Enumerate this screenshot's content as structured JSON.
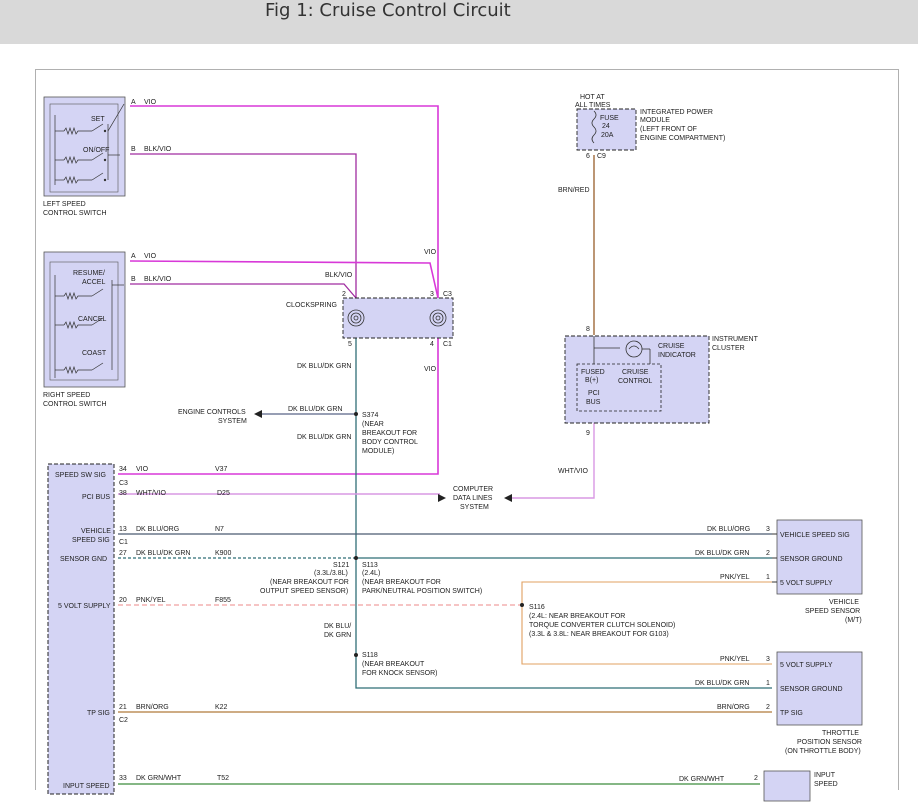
{
  "title": "Fig 1: Cruise Control Circuit",
  "colors": {
    "vio": "#d838d8",
    "blk_vio": "#a02ca0",
    "brn_red": "#a06a3a",
    "dk_blu_dk_grn": "#2f6e76",
    "wht_vio": "#d898e4",
    "pnk_yel": "#f0a0a0",
    "dk_blu_org": "#4a5a70",
    "brn_org": "#b07a3a",
    "dk_grn_wht": "#3c8c3c",
    "orange": "#e0a060",
    "component_fill": "#d4d4f4"
  },
  "labels": {
    "left_switch": [
      "LEFT SPEED",
      "CONTROL SWITCH"
    ],
    "set": "SET",
    "on_off": "ON/OFF",
    "right_switch": [
      "RIGHT SPEED",
      "CONTROL SWITCH"
    ],
    "resume_accel": [
      "RESUME/",
      "ACCEL"
    ],
    "cancel": "CANCEL",
    "coast": "COAST",
    "hot_at_all_times": [
      "HOT AT",
      "ALL TIMES"
    ],
    "fuse": [
      "FUSE",
      "24",
      "20A"
    ],
    "ipm": [
      "INTEGRATED POWER",
      "MODULE",
      "(LEFT FRONT OF",
      "ENGINE COMPARTMENT)"
    ],
    "clockspring": "CLOCKSPRING",
    "instrument_cluster": [
      "INSTRUMENT",
      "CLUSTER"
    ],
    "cruise_indicator": [
      "CRUISE",
      "INDICATOR"
    ],
    "fused_b": [
      "FUSED",
      "B(+)"
    ],
    "cruise_control": [
      "CRUISE",
      "CONTROL"
    ],
    "pci_bus_cluster": [
      "PCI",
      "BUS"
    ],
    "engine_controls": [
      "ENGINE CONTROLS",
      "SYSTEM"
    ],
    "s374": [
      "S374",
      "(NEAR",
      "BREAKOUT FOR",
      "BODY CONTROL",
      "MODULE)"
    ],
    "computer_data": [
      "COMPUTER",
      "DATA LINES",
      "SYSTEM"
    ],
    "s121": [
      "S121",
      "(3.3L/3.8L)",
      "(NEAR BREAKOUT FOR",
      "OUTPUT SPEED SENSOR)"
    ],
    "s113": [
      "S113",
      "(2.4L)",
      "(NEAR BREAKOUT FOR",
      "PARK/NEUTRAL POSITION SWITCH)"
    ],
    "s116": [
      "S116",
      "(2.4L: NEAR BREAKOUT FOR",
      "TORQUE CONVERTER CLUTCH SOLENOID)",
      "(3.3L & 3.8L: NEAR BREAKOUT FOR G103)"
    ],
    "s118": [
      "S118",
      "(NEAR BREAKOUT",
      "FOR KNOCK SENSOR)"
    ],
    "dk_blu_dk_grn_split": [
      "DK BLU/",
      "DK GRN"
    ],
    "vss_name": [
      "VEHICLE",
      "SPEED SENSOR",
      "(M/T)"
    ],
    "tps_name": [
      "THROTTLE",
      "POSITION SENSOR",
      "(ON THROTTLE BODY)"
    ],
    "input_speed": [
      "INPUT",
      "SPEED"
    ]
  },
  "wires": {
    "vio": "VIO",
    "blk_vio": "BLK/VIO",
    "brn_red": "BRN/RED",
    "dk_blu_dk_grn": "DK BLU/DK GRN",
    "wht_vio": "WHT/VIO",
    "dk_blu_org": "DK BLU/ORG",
    "pnk_yel": "PNK/YEL",
    "brn_org": "BRN/ORG",
    "dk_grn_wht": "DK GRN/WHT"
  },
  "pins": {
    "a": "A",
    "b": "B",
    "c3": "C3",
    "c1": "C1",
    "c9": "C9",
    "p2": "2",
    "p3": "3",
    "p4": "4",
    "p5": "5",
    "p6": "6",
    "p8": "8",
    "p9": "9",
    "p1": "1"
  },
  "pcm_rows": [
    {
      "name": "SPEED SW SIG",
      "pin": "34",
      "wire": "VIO",
      "circuit": "V37",
      "conn": "C3"
    },
    {
      "name": "PCI BUS",
      "pin": "38",
      "wire": "WHT/VIO",
      "circuit": "D25",
      "conn": ""
    },
    {
      "name": "VEHICLE SPEED SIG",
      "pin": "13",
      "wire": "DK BLU/ORG",
      "circuit": "N7",
      "conn": "C1"
    },
    {
      "name": "SENSOR GND",
      "pin": "27",
      "wire": "DK BLU/DK GRN",
      "circuit": "K900",
      "conn": ""
    },
    {
      "name": "5 VOLT SUPPLY",
      "pin": "20",
      "wire": "PNK/YEL",
      "circuit": "F855",
      "conn": ""
    },
    {
      "name": "TP SIG",
      "pin": "21",
      "wire": "BRN/ORG",
      "circuit": "K22",
      "conn": "C2"
    },
    {
      "name": "INPUT SPEED",
      "pin": "33",
      "wire": "DK GRN/WHT",
      "circuit": "T52",
      "conn": ""
    }
  ],
  "vss_pins": [
    {
      "pin": "3",
      "name": "VEHICLE SPEED SIG"
    },
    {
      "pin": "2",
      "name": "SENSOR GROUND"
    },
    {
      "pin": "1",
      "name": "5 VOLT SUPPLY"
    }
  ],
  "tps_pins": [
    {
      "pin": "3",
      "name": "5 VOLT SUPPLY"
    },
    {
      "pin": "1",
      "name": "SENSOR GROUND"
    },
    {
      "pin": "2",
      "name": "TP SIG"
    }
  ]
}
